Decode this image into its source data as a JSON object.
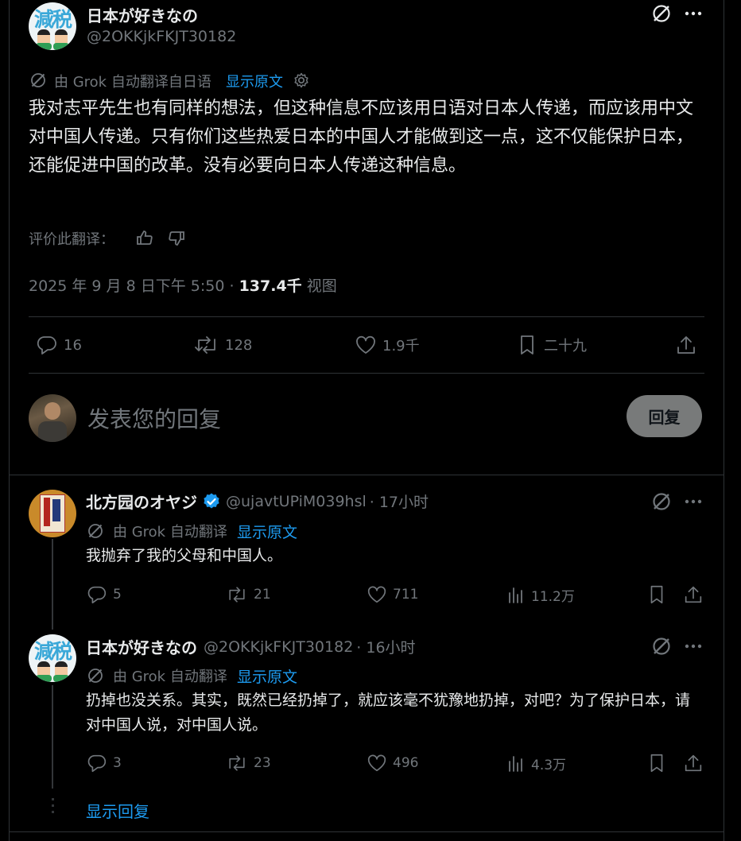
{
  "main_post": {
    "author_name": "日本が好きなの",
    "author_handle": "@2OKKjkFKJT30182",
    "avatar_text": "減税",
    "translation_note": "由 Grok 自动翻译自日语",
    "show_original": "显示原文",
    "text": "我对志平先生也有同样的想法，但这种信息不应该用日语对日本人传递，而应该用中文对中国人传递。只有你们这些热爱日本的中国人才能做到这一点，这不仅能保护日本，还能促进中国的改革。没有必要向日本人传递这种信息。",
    "rate_translation": "评价此翻译：",
    "timestamp": "2025 年 9 月 8 日下午 5:50",
    "separator": "·",
    "views_count": "137.4千",
    "views_label": "视图",
    "replies": "16",
    "reposts": "128",
    "likes": "1.9千",
    "bookmarks": "二十九"
  },
  "composer": {
    "placeholder": "发表您的回复",
    "reply_button": "回复"
  },
  "replies": [
    {
      "author_name": "北方园のオヤジ",
      "verified": true,
      "author_handle": "@ujavtUPiM039hsl",
      "time": "· 17小时",
      "translation_note": "由 Grok 自动翻译",
      "show_original": "显示原文",
      "text": "我抛弃了我的父母和中国人。",
      "replies": "5",
      "reposts": "21",
      "likes": "711",
      "views": "11.2万"
    },
    {
      "author_name": "日本が好きなの",
      "author_handle": "@2OKKjkFKJT30182",
      "time": "· 16小时",
      "translation_note": "由 Grok 自动翻译",
      "show_original": "显示原文",
      "text": "扔掉也没关系。其实，既然已经扔掉了，就应该毫不犹豫地扔掉，对吧？为了保护日本，请对中国人说，对中国人说。",
      "replies": "3",
      "reposts": "23",
      "likes": "496",
      "views": "4.3万"
    }
  ],
  "show_replies": "显示回复",
  "colors": {
    "background": "#000000",
    "text": "#e7e9ea",
    "muted": "#71767b",
    "link": "#1d9bf0",
    "verified": "#1d9bf0",
    "reply_button": "#787a7a"
  }
}
